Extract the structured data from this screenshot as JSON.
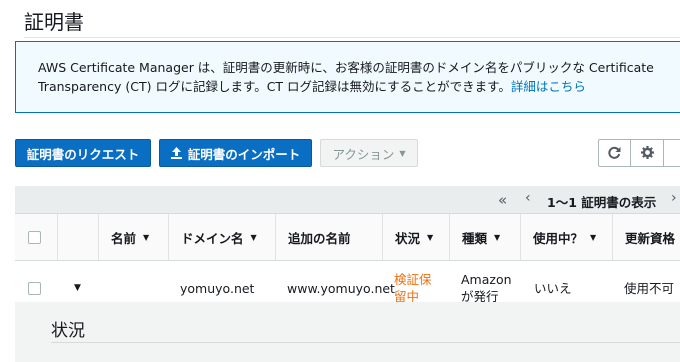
{
  "page": {
    "title": "証明書"
  },
  "info_banner": {
    "text": "AWS Certificate Manager は、証明書の更新時に、お客様の証明書のドメイン名をパブリックな Certificate Transparency (CT) ログに記録します。CT ログ記録は無効にすることができます。",
    "link_text": "詳細はこちら"
  },
  "toolbar": {
    "request_label": "証明書のリクエスト",
    "import_label": "証明書のインポート",
    "actions_label": "アクション",
    "icons": [
      "refresh-icon",
      "gear-icon"
    ]
  },
  "pagination": {
    "text": "1〜1 証明書の表示"
  },
  "table": {
    "columns": [
      {
        "label": "名前",
        "sortable": true
      },
      {
        "label": "ドメイン名",
        "sortable": true
      },
      {
        "label": "追加の名前",
        "sortable": false
      },
      {
        "label": "状況",
        "sortable": true
      },
      {
        "label": "種類",
        "sortable": true
      },
      {
        "label": "使用中？",
        "sortable": true
      },
      {
        "label": "更新資格",
        "sortable": false
      }
    ],
    "rows": [
      {
        "name": "",
        "domain": "yomuyo.net",
        "additional_names": "www.yomuyo.net",
        "status": "検証保留中",
        "type": "Amazon が発行",
        "in_use": "いいえ",
        "renewal_eligibility": "使用不可"
      }
    ]
  },
  "detail": {
    "section_title": "状況"
  },
  "colors": {
    "primary_button": "#0a6fc2",
    "banner_border": "#0073bb",
    "banner_bg": "#f1faff",
    "pending_status": "#ec7211",
    "link": "#0073bb"
  }
}
